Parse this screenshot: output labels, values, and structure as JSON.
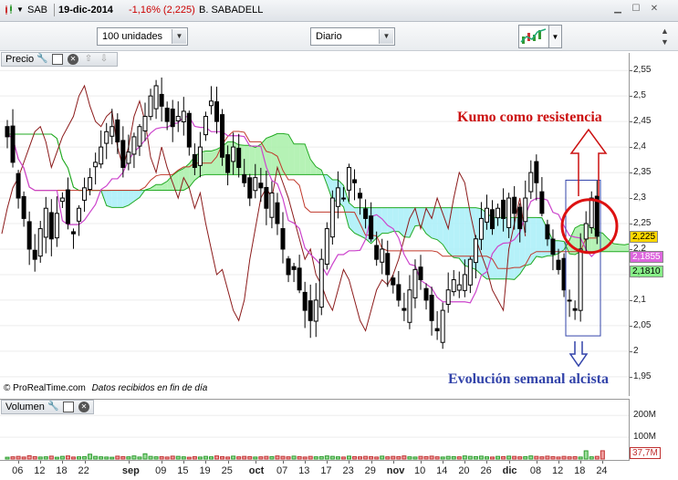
{
  "titlebar": {
    "symbol": "SAB",
    "date": "19-dic-2014",
    "change": "-1,16% (2,225)",
    "name": "B. SABADELL",
    "change_color": "#cc0000"
  },
  "toolbar": {
    "quantity": "100 unidades",
    "period": "Diario"
  },
  "price_panel": {
    "title": "Precio",
    "credit": "© ProRealTime.com",
    "credit_note": "Datos recibidos en fin de día",
    "y_ticks": [
      "2,55",
      "2,5",
      "2,45",
      "2,4",
      "2,35",
      "2,3",
      "2,25",
      "2,2",
      "2,15",
      "2,1",
      "2,05",
      "2",
      "1,95"
    ],
    "y_ticks_values": [
      2.55,
      2.5,
      2.45,
      2.4,
      2.35,
      2.3,
      2.25,
      2.2,
      2.15,
      2.1,
      2.05,
      2.0,
      1.95
    ],
    "ylim": [
      1.93,
      2.57
    ],
    "badges": [
      {
        "text": "2,225",
        "value": 2.225,
        "bg": "#ffd800",
        "fg": "#000000"
      },
      {
        "text": "2,1855",
        "value": 2.1855,
        "bg": "#dd66dd",
        "fg": "#ffffff"
      },
      {
        "text": "2,1810",
        "value": 2.168,
        "bg": "#88ee88",
        "fg": "#000000"
      }
    ]
  },
  "volume_panel": {
    "title": "Volumen",
    "y_ticks": [
      "200M",
      "100M"
    ],
    "y_tick_values": [
      200,
      100
    ],
    "ylim": [
      0,
      260
    ],
    "badge": {
      "text": "37,7M",
      "value": 37.7
    }
  },
  "x_axis": {
    "labels": [
      {
        "t": "06",
        "i": 2,
        "bold": false
      },
      {
        "t": "12",
        "i": 6,
        "bold": false
      },
      {
        "t": "18",
        "i": 10,
        "bold": false
      },
      {
        "t": "22",
        "i": 14,
        "bold": false
      },
      {
        "t": "sep",
        "i": 22,
        "bold": true
      },
      {
        "t": "09",
        "i": 28,
        "bold": false
      },
      {
        "t": "15",
        "i": 32,
        "bold": false
      },
      {
        "t": "19",
        "i": 36,
        "bold": false
      },
      {
        "t": "25",
        "i": 40,
        "bold": false
      },
      {
        "t": "oct",
        "i": 45,
        "bold": true
      },
      {
        "t": "07",
        "i": 50,
        "bold": false
      },
      {
        "t": "13",
        "i": 54,
        "bold": false
      },
      {
        "t": "17",
        "i": 58,
        "bold": false
      },
      {
        "t": "23",
        "i": 62,
        "bold": false
      },
      {
        "t": "29",
        "i": 66,
        "bold": false
      },
      {
        "t": "nov",
        "i": 70,
        "bold": true
      },
      {
        "t": "10",
        "i": 75,
        "bold": false
      },
      {
        "t": "14",
        "i": 79,
        "bold": false
      },
      {
        "t": "20",
        "i": 83,
        "bold": false
      },
      {
        "t": "26",
        "i": 87,
        "bold": false
      },
      {
        "t": "dic",
        "i": 91,
        "bold": true
      },
      {
        "t": "08",
        "i": 96,
        "bold": false
      },
      {
        "t": "12",
        "i": 100,
        "bold": false
      },
      {
        "t": "18",
        "i": 104,
        "bold": false
      },
      {
        "t": "24",
        "i": 108,
        "bold": false
      }
    ]
  },
  "annotations": {
    "resistance": "Kumo como resistencia",
    "resistance_color": "#cc1111",
    "weekly": "Evolución semanal alcista",
    "weekly_color": "#3344aa"
  },
  "chart_data": {
    "type": "candlestick",
    "closes": [
      2.42,
      2.37,
      2.3,
      2.26,
      2.2,
      2.18,
      2.24,
      2.28,
      2.22,
      2.27,
      2.3,
      2.25,
      2.23,
      2.28,
      2.32,
      2.34,
      2.37,
      2.4,
      2.43,
      2.44,
      2.41,
      2.36,
      2.39,
      2.42,
      2.44,
      2.46,
      2.5,
      2.52,
      2.48,
      2.45,
      2.44,
      2.46,
      2.47,
      2.4,
      2.36,
      2.4,
      2.46,
      2.49,
      2.45,
      2.38,
      2.35,
      2.4,
      2.36,
      2.33,
      2.3,
      2.34,
      2.32,
      2.28,
      2.31,
      2.25,
      2.2,
      2.15,
      2.16,
      2.12,
      2.08,
      2.06,
      2.1,
      2.18,
      2.24,
      2.3,
      2.32,
      2.3,
      2.36,
      2.33,
      2.3,
      2.26,
      2.22,
      2.18,
      2.2,
      2.15,
      2.13,
      2.1,
      2.08,
      2.12,
      2.16,
      2.14,
      2.1,
      2.06,
      2.04,
      2.08,
      2.12,
      2.14,
      2.13,
      2.15,
      2.18,
      2.22,
      2.26,
      2.28,
      2.24,
      2.28,
      2.26,
      2.3,
      2.27,
      2.24,
      2.3,
      2.35,
      2.33,
      2.27,
      2.22,
      2.19,
      2.16,
      2.12,
      2.1,
      2.08,
      2.2,
      2.25,
      2.3,
      2.225
    ],
    "vol_closes": [
      8,
      10,
      12,
      9,
      15,
      11,
      9,
      10,
      13,
      8,
      12,
      14,
      9,
      10,
      11,
      22,
      12,
      10,
      9,
      8,
      13,
      11,
      10,
      14,
      9,
      24,
      12,
      10,
      11,
      9,
      13,
      12,
      10,
      8,
      11,
      9,
      12,
      10,
      14,
      11,
      9,
      13,
      10,
      12,
      11,
      9,
      10,
      12,
      11,
      14,
      12,
      10,
      13,
      11,
      9,
      12,
      10,
      11,
      14,
      12,
      10,
      9,
      13,
      11,
      10,
      12,
      11,
      9,
      13,
      10,
      12,
      11,
      14,
      10,
      9,
      12,
      11,
      13,
      10,
      9,
      12,
      11,
      10,
      14,
      12,
      11,
      13,
      10,
      9,
      12,
      11,
      13,
      12,
      10,
      11,
      14,
      12,
      10,
      13,
      11,
      9,
      12,
      10,
      11,
      9,
      37.7,
      10,
      12,
      38
    ]
  }
}
